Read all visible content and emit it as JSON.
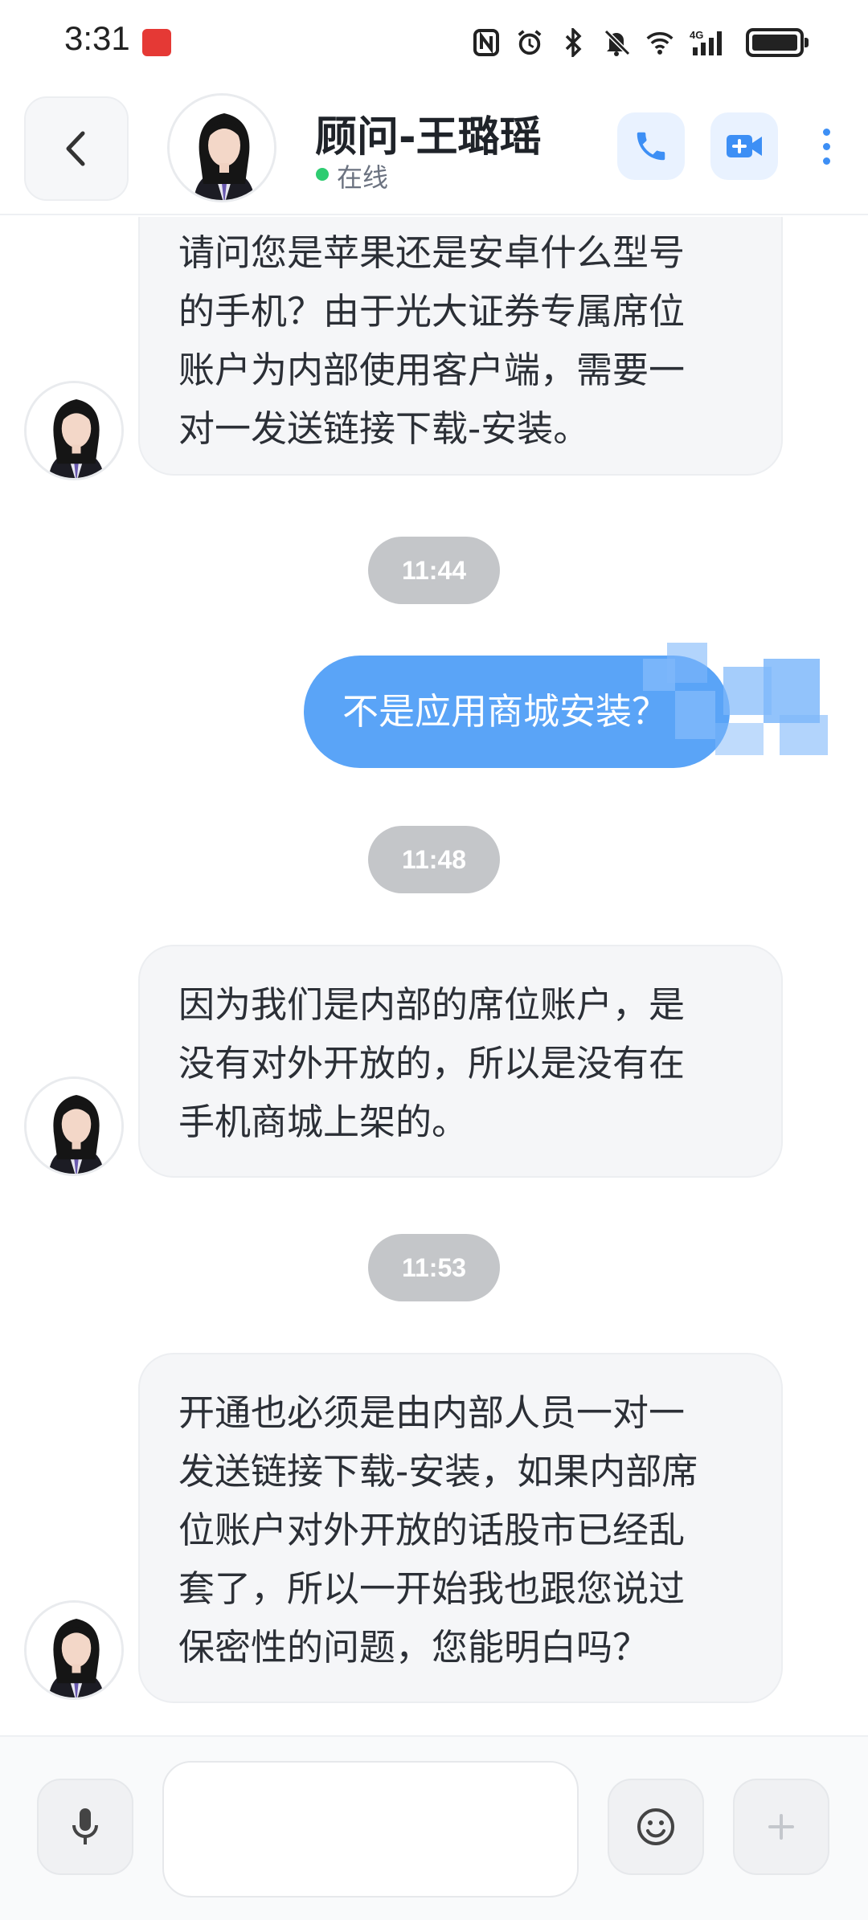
{
  "status_bar": {
    "time": "3:31",
    "app_icon": "huawei-app-icon",
    "icons": [
      "nfc-icon",
      "alarm-icon",
      "bluetooth-icon",
      "mute-icon",
      "wifi-icon",
      "4g-signal-icon",
      "battery-icon"
    ]
  },
  "header": {
    "contact_name": "顾问-王璐瑶",
    "status_text": "在线",
    "status_color": "#2ecc71",
    "accent_color": "#3d8ff5",
    "icons": [
      "back-icon",
      "phone-icon",
      "video-icon",
      "more-icon"
    ]
  },
  "messages": [
    {
      "side": "in",
      "lines": [
        "请问您是苹果还是安卓什么型号",
        "的手机？由于光大证券专属席位",
        "账户为内部使用客户端，需要一",
        "对一发送链接下载-安装。"
      ]
    },
    {
      "type": "time",
      "text": "11:44"
    },
    {
      "side": "out",
      "text": "不是应用商城安装？"
    },
    {
      "type": "time",
      "text": "11:48"
    },
    {
      "side": "in",
      "lines": [
        "因为我们是内部的席位账户，是",
        "没有对外开放的，所以是没有在",
        "手机商城上架的。"
      ]
    },
    {
      "type": "time",
      "text": "11:53"
    },
    {
      "side": "in",
      "lines": [
        "开通也必须是由内部人员一对一",
        "发送链接下载-安装，如果内部席",
        "位账户对外开放的话股市已经乱",
        "套了，所以一开始我也跟您说过",
        "保密性的问题，您能明白吗？"
      ]
    }
  ],
  "input_bar": {
    "placeholder": "",
    "value": "",
    "icons": [
      "mic-icon",
      "emoji-icon",
      "plus-icon"
    ]
  }
}
